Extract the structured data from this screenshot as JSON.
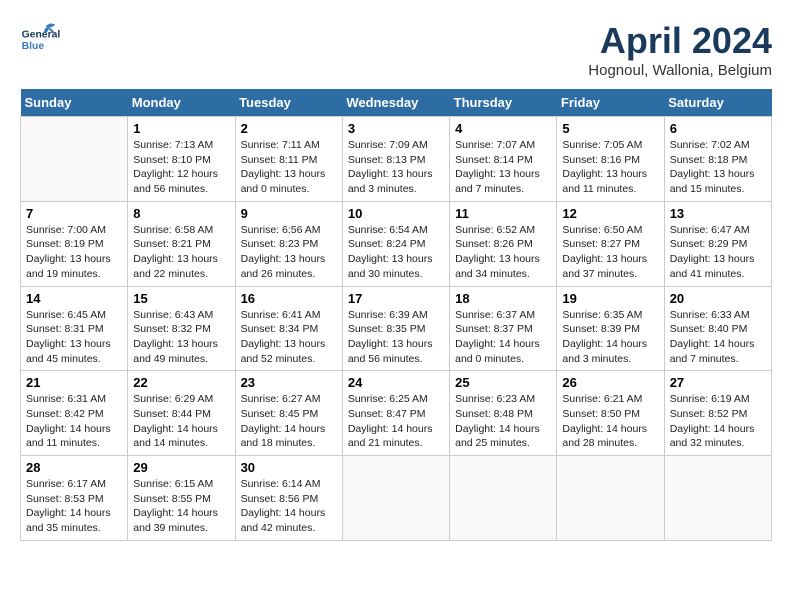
{
  "header": {
    "logo_general": "General",
    "logo_blue": "Blue",
    "title": "April 2024",
    "subtitle": "Hognoul, Wallonia, Belgium"
  },
  "calendar": {
    "days": [
      "Sunday",
      "Monday",
      "Tuesday",
      "Wednesday",
      "Thursday",
      "Friday",
      "Saturday"
    ],
    "weeks": [
      [
        {
          "date": "",
          "content": ""
        },
        {
          "date": "1",
          "content": "Sunrise: 7:13 AM\nSunset: 8:10 PM\nDaylight: 12 hours\nand 56 minutes."
        },
        {
          "date": "2",
          "content": "Sunrise: 7:11 AM\nSunset: 8:11 PM\nDaylight: 13 hours\nand 0 minutes."
        },
        {
          "date": "3",
          "content": "Sunrise: 7:09 AM\nSunset: 8:13 PM\nDaylight: 13 hours\nand 3 minutes."
        },
        {
          "date": "4",
          "content": "Sunrise: 7:07 AM\nSunset: 8:14 PM\nDaylight: 13 hours\nand 7 minutes."
        },
        {
          "date": "5",
          "content": "Sunrise: 7:05 AM\nSunset: 8:16 PM\nDaylight: 13 hours\nand 11 minutes."
        },
        {
          "date": "6",
          "content": "Sunrise: 7:02 AM\nSunset: 8:18 PM\nDaylight: 13 hours\nand 15 minutes."
        }
      ],
      [
        {
          "date": "7",
          "content": "Sunrise: 7:00 AM\nSunset: 8:19 PM\nDaylight: 13 hours\nand 19 minutes."
        },
        {
          "date": "8",
          "content": "Sunrise: 6:58 AM\nSunset: 8:21 PM\nDaylight: 13 hours\nand 22 minutes."
        },
        {
          "date": "9",
          "content": "Sunrise: 6:56 AM\nSunset: 8:23 PM\nDaylight: 13 hours\nand 26 minutes."
        },
        {
          "date": "10",
          "content": "Sunrise: 6:54 AM\nSunset: 8:24 PM\nDaylight: 13 hours\nand 30 minutes."
        },
        {
          "date": "11",
          "content": "Sunrise: 6:52 AM\nSunset: 8:26 PM\nDaylight: 13 hours\nand 34 minutes."
        },
        {
          "date": "12",
          "content": "Sunrise: 6:50 AM\nSunset: 8:27 PM\nDaylight: 13 hours\nand 37 minutes."
        },
        {
          "date": "13",
          "content": "Sunrise: 6:47 AM\nSunset: 8:29 PM\nDaylight: 13 hours\nand 41 minutes."
        }
      ],
      [
        {
          "date": "14",
          "content": "Sunrise: 6:45 AM\nSunset: 8:31 PM\nDaylight: 13 hours\nand 45 minutes."
        },
        {
          "date": "15",
          "content": "Sunrise: 6:43 AM\nSunset: 8:32 PM\nDaylight: 13 hours\nand 49 minutes."
        },
        {
          "date": "16",
          "content": "Sunrise: 6:41 AM\nSunset: 8:34 PM\nDaylight: 13 hours\nand 52 minutes."
        },
        {
          "date": "17",
          "content": "Sunrise: 6:39 AM\nSunset: 8:35 PM\nDaylight: 13 hours\nand 56 minutes."
        },
        {
          "date": "18",
          "content": "Sunrise: 6:37 AM\nSunset: 8:37 PM\nDaylight: 14 hours\nand 0 minutes."
        },
        {
          "date": "19",
          "content": "Sunrise: 6:35 AM\nSunset: 8:39 PM\nDaylight: 14 hours\nand 3 minutes."
        },
        {
          "date": "20",
          "content": "Sunrise: 6:33 AM\nSunset: 8:40 PM\nDaylight: 14 hours\nand 7 minutes."
        }
      ],
      [
        {
          "date": "21",
          "content": "Sunrise: 6:31 AM\nSunset: 8:42 PM\nDaylight: 14 hours\nand 11 minutes."
        },
        {
          "date": "22",
          "content": "Sunrise: 6:29 AM\nSunset: 8:44 PM\nDaylight: 14 hours\nand 14 minutes."
        },
        {
          "date": "23",
          "content": "Sunrise: 6:27 AM\nSunset: 8:45 PM\nDaylight: 14 hours\nand 18 minutes."
        },
        {
          "date": "24",
          "content": "Sunrise: 6:25 AM\nSunset: 8:47 PM\nDaylight: 14 hours\nand 21 minutes."
        },
        {
          "date": "25",
          "content": "Sunrise: 6:23 AM\nSunset: 8:48 PM\nDaylight: 14 hours\nand 25 minutes."
        },
        {
          "date": "26",
          "content": "Sunrise: 6:21 AM\nSunset: 8:50 PM\nDaylight: 14 hours\nand 28 minutes."
        },
        {
          "date": "27",
          "content": "Sunrise: 6:19 AM\nSunset: 8:52 PM\nDaylight: 14 hours\nand 32 minutes."
        }
      ],
      [
        {
          "date": "28",
          "content": "Sunrise: 6:17 AM\nSunset: 8:53 PM\nDaylight: 14 hours\nand 35 minutes."
        },
        {
          "date": "29",
          "content": "Sunrise: 6:15 AM\nSunset: 8:55 PM\nDaylight: 14 hours\nand 39 minutes."
        },
        {
          "date": "30",
          "content": "Sunrise: 6:14 AM\nSunset: 8:56 PM\nDaylight: 14 hours\nand 42 minutes."
        },
        {
          "date": "",
          "content": ""
        },
        {
          "date": "",
          "content": ""
        },
        {
          "date": "",
          "content": ""
        },
        {
          "date": "",
          "content": ""
        }
      ]
    ]
  }
}
